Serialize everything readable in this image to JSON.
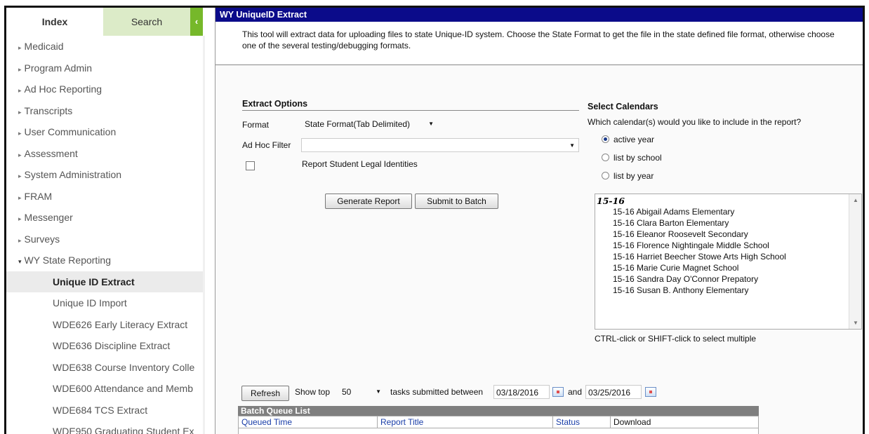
{
  "nav": {
    "tabs": {
      "index": "Index",
      "search": "Search",
      "collapse": "‹"
    },
    "items": [
      {
        "label": "Medicaid",
        "arrow": "▸"
      },
      {
        "label": "Program Admin",
        "arrow": "▸"
      },
      {
        "label": "Ad Hoc Reporting",
        "arrow": "▸"
      },
      {
        "label": "Transcripts",
        "arrow": "▸"
      },
      {
        "label": "User Communication",
        "arrow": "▸"
      },
      {
        "label": "Assessment",
        "arrow": "▸"
      },
      {
        "label": "System Administration",
        "arrow": "▸"
      },
      {
        "label": "FRAM",
        "arrow": "▸"
      },
      {
        "label": "Messenger",
        "arrow": "▸"
      },
      {
        "label": "Surveys",
        "arrow": "▸"
      },
      {
        "label": "WY State Reporting",
        "arrow": "▾"
      }
    ],
    "subitems": [
      "Unique ID Extract",
      "Unique ID Import",
      "WDE626 Early Literacy Extract",
      "WDE636 Discipline Extract",
      "WDE638 Course Inventory Colle",
      "WDE600 Attendance and Memb",
      "WDE684 TCS Extract",
      "WDE950 Graduating Student Ex"
    ]
  },
  "main": {
    "title": "WY UniqueID Extract",
    "description": "This tool will extract data for uploading files to state Unique-ID system. Choose the State Format to get the file in the state defined file format, otherwise choose one of the several testing/debugging formats."
  },
  "extract": {
    "heading": "Extract Options",
    "format_label": "Format",
    "format_value": "State Format(Tab Delimited)",
    "adhoc_label": "Ad Hoc Filter",
    "adhoc_value": "",
    "legal_label": "Report Student Legal Identities",
    "generate_btn": "Generate Report",
    "batch_btn": "Submit to Batch"
  },
  "calendars": {
    "heading": "Select Calendars",
    "question": "Which calendar(s) would you like to include in the report?",
    "radios": [
      "active year",
      "list by school",
      "list by year"
    ],
    "selected_radio": "active year",
    "group": "15-16",
    "options": [
      "15-16 Abigail Adams Elementary",
      "15-16 Clara Barton Elementary",
      "15-16 Eleanor Roosevelt Secondary",
      "15-16 Florence Nightingale Middle School",
      "15-16 Harriet Beecher Stowe Arts High School",
      "15-16 Marie Curie Magnet School",
      "15-16 Sandra Day O'Connor Prepatory",
      "15-16 Susan B. Anthony Elementary"
    ],
    "hint": "CTRL-click or SHIFT-click to select multiple"
  },
  "batch": {
    "refresh_btn": "Refresh",
    "show_top": "Show top",
    "top_value": "50",
    "between": "tasks submitted between",
    "start_date": "03/18/2016",
    "and": "and",
    "end_date": "03/25/2016",
    "list_title": "Batch Queue List",
    "columns": [
      "Queued Time",
      "Report Title",
      "Status",
      "Download"
    ]
  },
  "colors": {
    "accent_green": "#76b82a",
    "titlebar": "#0b0b8a",
    "link_blue": "#1a3ea8"
  }
}
